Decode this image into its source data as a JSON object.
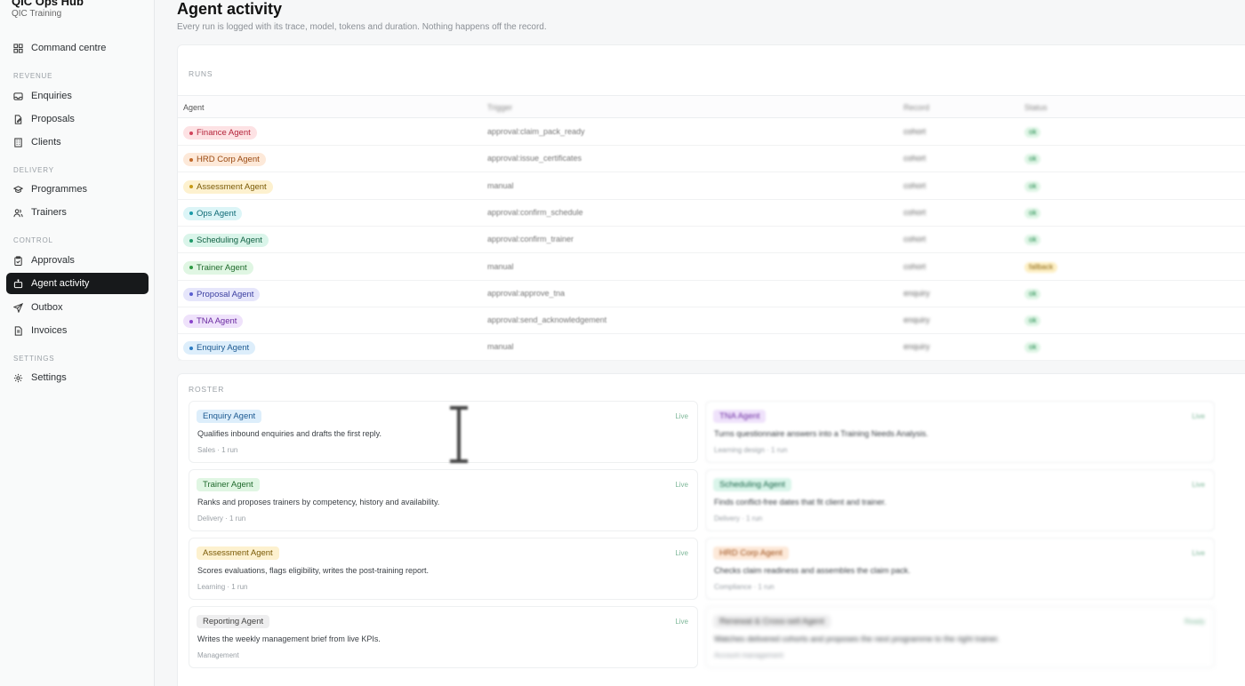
{
  "brand": {
    "title": "QIC Ops Hub",
    "subtitle": "QIC Training"
  },
  "sidebar": {
    "command": {
      "label": "Command centre",
      "icon": "grid-icon"
    },
    "sections": [
      {
        "label": "REVENUE",
        "items": [
          {
            "label": "Enquiries",
            "icon": "inbox-icon"
          },
          {
            "label": "Proposals",
            "icon": "file-edit-icon"
          },
          {
            "label": "Clients",
            "icon": "building-icon"
          }
        ]
      },
      {
        "label": "DELIVERY",
        "items": [
          {
            "label": "Programmes",
            "icon": "graduation-cap-icon"
          },
          {
            "label": "Trainers",
            "icon": "users-icon"
          }
        ]
      },
      {
        "label": "CONTROL",
        "items": [
          {
            "label": "Approvals",
            "icon": "clipboard-check-icon"
          },
          {
            "label": "Agent activity",
            "icon": "bot-icon",
            "active": true
          },
          {
            "label": "Outbox",
            "icon": "send-icon"
          },
          {
            "label": "Invoices",
            "icon": "receipt-icon"
          }
        ]
      },
      {
        "label": "SETTINGS",
        "items": [
          {
            "label": "Settings",
            "icon": "gear-icon"
          }
        ]
      }
    ]
  },
  "page": {
    "title": "Agent activity",
    "subtitle": "Every run is logged with its trace, model, tokens and duration. Nothing happens off the record."
  },
  "runs": {
    "label": "RUNS",
    "columns": [
      "Agent",
      "Trigger",
      "Record",
      "Status"
    ],
    "rows": [
      {
        "agent": "Finance Agent",
        "trigger": "approval:claim_pack_ready",
        "record": "cohort",
        "status": "ok",
        "color": "#fde2e4",
        "text": "#b4233a",
        "dot": "#d1435b"
      },
      {
        "agent": "HRD Corp Agent",
        "trigger": "approval:issue_certificates",
        "record": "cohort",
        "status": "ok",
        "color": "#fde9d9",
        "text": "#9a4a12",
        "dot": "#c26a2b"
      },
      {
        "agent": "Assessment Agent",
        "trigger": "manual",
        "record": "cohort",
        "status": "ok",
        "color": "#fdf1cf",
        "text": "#7a5a06",
        "dot": "#c69a18"
      },
      {
        "agent": "Ops Agent",
        "trigger": "approval:confirm_schedule",
        "record": "cohort",
        "status": "ok",
        "color": "#dcf5f7",
        "text": "#0e6a75",
        "dot": "#1a9aa8"
      },
      {
        "agent": "Scheduling Agent",
        "trigger": "approval:confirm_trainer",
        "record": "cohort",
        "status": "ok",
        "color": "#daf5ea",
        "text": "#136245",
        "dot": "#1f9a6a"
      },
      {
        "agent": "Trainer Agent",
        "trigger": "manual",
        "record": "cohort",
        "status": "fallback",
        "color": "#e0f6e3",
        "text": "#1f6a2c",
        "dot": "#2f9a44"
      },
      {
        "agent": "Proposal Agent",
        "trigger": "approval:approve_tna",
        "record": "enquiry",
        "status": "ok",
        "color": "#e6e6fb",
        "text": "#3b3ea0",
        "dot": "#5a5ed0"
      },
      {
        "agent": "TNA Agent",
        "trigger": "approval:send_acknowledgement",
        "record": "enquiry",
        "status": "ok",
        "color": "#efe2fb",
        "text": "#6a2aa0",
        "dot": "#8a44cc"
      },
      {
        "agent": "Enquiry Agent",
        "trigger": "manual",
        "record": "enquiry",
        "status": "ok",
        "color": "#ddeefb",
        "text": "#1d5a92",
        "dot": "#2c7cc4"
      }
    ]
  },
  "roster": {
    "label": "ROSTER",
    "left": [
      {
        "name": "Enquiry Agent",
        "desc": "Qualifies inbound enquiries and drafts the first reply.",
        "meta": "Sales · 1 run",
        "state": "Live",
        "bg": "#ddeefb",
        "fg": "#1d5a92",
        "blur": false
      },
      {
        "name": "Trainer Agent",
        "desc": "Ranks and proposes trainers by competency, history and availability.",
        "meta": "Delivery · 1 run",
        "state": "Live",
        "bg": "#e0f6e3",
        "fg": "#1f6a2c",
        "blur": false
      },
      {
        "name": "Assessment Agent",
        "desc": "Scores evaluations, flags eligibility, writes the post-training report.",
        "meta": "Learning · 1 run",
        "state": "Live",
        "bg": "#fdf1cf",
        "fg": "#7a5a06",
        "blur": false
      },
      {
        "name": "Reporting Agent",
        "desc": "Writes the weekly management brief from live KPIs.",
        "meta": "Management",
        "state": "Live",
        "bg": "#eeeeef",
        "fg": "#444",
        "blur": false
      }
    ],
    "right": [
      {
        "name": "TNA Agent",
        "desc": "Turns questionnaire answers into a Training Needs Analysis.",
        "meta": "Learning design · 1 run",
        "state": "Live",
        "bg": "#efe2fb",
        "fg": "#6a2aa0"
      },
      {
        "name": "Scheduling Agent",
        "desc": "Finds conflict-free dates that fit client and trainer.",
        "meta": "Delivery · 1 run",
        "state": "Live",
        "bg": "#daf5ea",
        "fg": "#136245"
      },
      {
        "name": "HRD Corp Agent",
        "desc": "Checks claim readiness and assembles the claim pack.",
        "meta": "Compliance · 1 run",
        "state": "Live",
        "bg": "#fde9d9",
        "fg": "#9a4a12"
      },
      {
        "name": "Renewal & Cross-sell Agent",
        "desc": "Watches delivered cohorts and proposes the next programme to the right trainer.",
        "meta": "Account management",
        "state": "Ready",
        "bg": "#eeeeef",
        "fg": "#444"
      }
    ]
  },
  "colors": {
    "active_nav": "#17191b",
    "ok_bg": "#dff5e6",
    "ok_fg": "#1f8a4c",
    "fallback_bg": "#fdefc4",
    "fallback_fg": "#8a6410"
  }
}
